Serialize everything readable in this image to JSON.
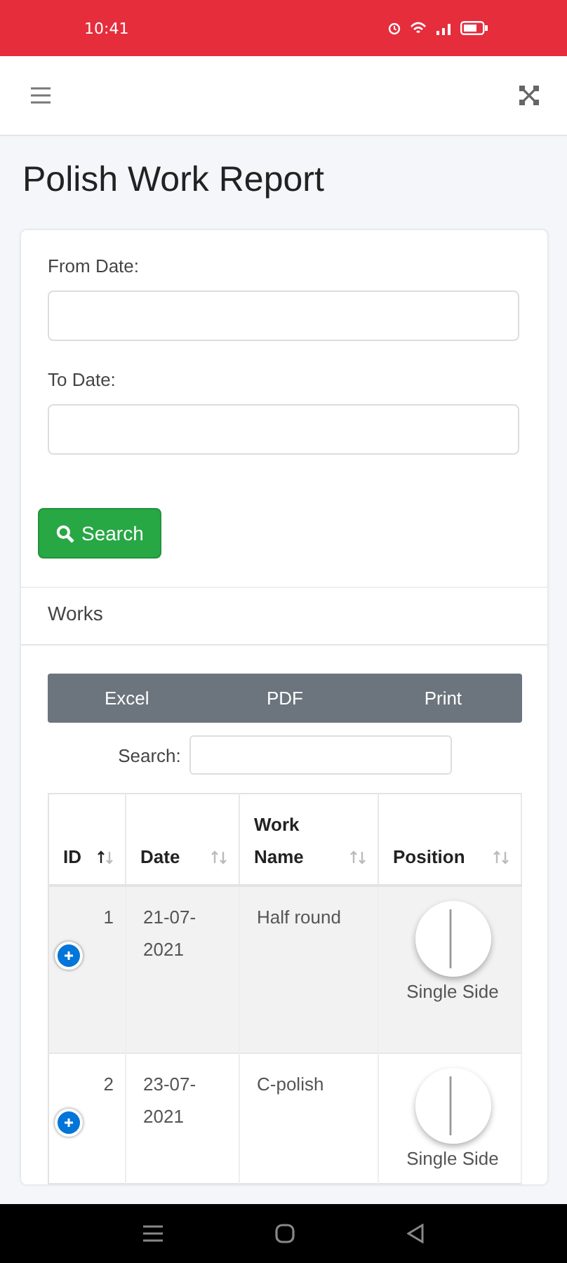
{
  "status_bar": {
    "time": "10:41"
  },
  "page": {
    "title": "Polish Work Report"
  },
  "filters": [
    {
      "label": "From Date:"
    },
    {
      "label": "To Date:"
    }
  ],
  "search_button": "Search",
  "section_title": "Works",
  "export_buttons": [
    "Excel",
    "PDF",
    "Print"
  ],
  "table_search": {
    "label": "Search:"
  },
  "table": {
    "columns": [
      {
        "label": "ID",
        "sorted": true
      },
      {
        "label": "Date",
        "sorted": false
      },
      {
        "label": "Work Name",
        "sorted": false
      },
      {
        "label": "Position",
        "sorted": false
      }
    ],
    "rows": [
      {
        "id": "1",
        "date": "21-07-2021",
        "work_name": "Half round",
        "position": "Single Side"
      },
      {
        "id": "2",
        "date": "23-07-2021",
        "work_name": "C-polish",
        "position": "Single Side"
      }
    ]
  }
}
